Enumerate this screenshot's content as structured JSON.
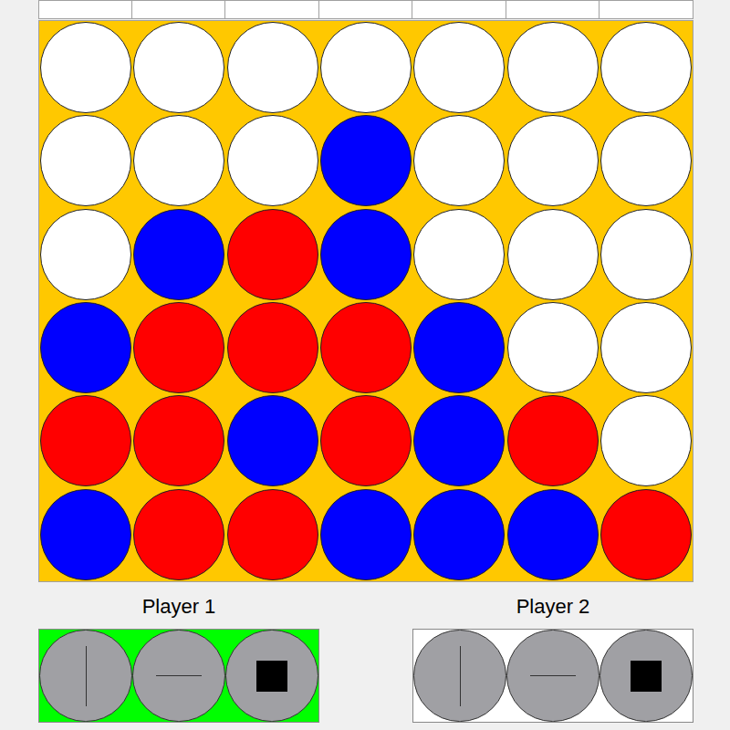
{
  "board": {
    "rows": [
      [
        {
          "color": "#ffffff"
        },
        {
          "color": "#ffffff"
        },
        {
          "color": "#ffffff"
        },
        {
          "color": "#ffffff"
        },
        {
          "color": "#ffffff"
        },
        {
          "color": "#ffffff"
        },
        {
          "color": "#ffffff"
        }
      ],
      [
        {
          "color": "#ffffff"
        },
        {
          "color": "#ffffff"
        },
        {
          "color": "#ffffff"
        },
        {
          "color": "#0000ff"
        },
        {
          "color": "#ffffff"
        },
        {
          "color": "#ffffff"
        },
        {
          "color": "#ffffff"
        }
      ],
      [
        {
          "color": "#ffffff"
        },
        {
          "color": "#0000ff"
        },
        {
          "color": "#ff0000"
        },
        {
          "color": "#0000ff"
        },
        {
          "color": "#ffffff"
        },
        {
          "color": "#ffffff"
        },
        {
          "color": "#ffffff"
        }
      ],
      [
        {
          "color": "#0000ff"
        },
        {
          "color": "#ff0000"
        },
        {
          "color": "#ff0000"
        },
        {
          "color": "#ff0000"
        },
        {
          "color": "#0000ff"
        },
        {
          "color": "#ffffff"
        },
        {
          "color": "#ffffff"
        }
      ],
      [
        {
          "color": "#ff0000"
        },
        {
          "color": "#ff0000"
        },
        {
          "color": "#0000ff"
        },
        {
          "color": "#ff0000"
        },
        {
          "color": "#0000ff"
        },
        {
          "color": "#ff0000"
        },
        {
          "color": "#ffffff"
        }
      ],
      [
        {
          "color": "#0000ff"
        },
        {
          "color": "#ff0000"
        },
        {
          "color": "#ff0000"
        },
        {
          "color": "#0000ff"
        },
        {
          "color": "#0000ff"
        },
        {
          "color": "#0000ff"
        },
        {
          "color": "#ff0000"
        }
      ]
    ]
  },
  "players": [
    {
      "label": "Player 1",
      "selected": true
    },
    {
      "label": "Player 2",
      "selected": false
    }
  ]
}
